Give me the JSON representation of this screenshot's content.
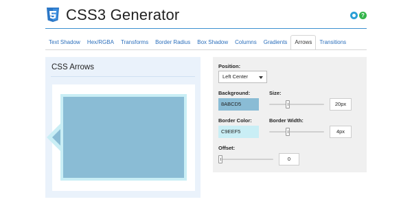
{
  "header": {
    "title": "CSS3 Generator",
    "logo_icon": "css3-shield-icon",
    "settings_icon": "settings-icon",
    "help_icon": "help-icon",
    "help_glyph": "?",
    "accent_color": "#3a8fd0"
  },
  "tabs": [
    {
      "label": "Text Shadow",
      "active": false
    },
    {
      "label": "Hex/RGBA",
      "active": false
    },
    {
      "label": "Transforms",
      "active": false
    },
    {
      "label": "Border Radius",
      "active": false
    },
    {
      "label": "Box Shadow",
      "active": false
    },
    {
      "label": "Columns",
      "active": false
    },
    {
      "label": "Gradients",
      "active": false
    },
    {
      "label": "Arrows",
      "active": true
    },
    {
      "label": "Transitions",
      "active": false
    }
  ],
  "preview": {
    "title": "CSS Arrows",
    "box_color": "#8ABCD5",
    "border_color": "#C9EEF5"
  },
  "controls": {
    "position": {
      "label": "Position:",
      "value": "Left Center"
    },
    "background": {
      "label": "Background:",
      "value": "8ABCD5"
    },
    "size": {
      "label": "Size:",
      "value": "20px",
      "level": 0.33
    },
    "border_color": {
      "label": "Border Color:",
      "value": "C9EEF5"
    },
    "border_width": {
      "label": "Border Width:",
      "value": "4px",
      "level": 0.33
    },
    "offset": {
      "label": "Offset:",
      "value": "0",
      "level": 0
    }
  }
}
